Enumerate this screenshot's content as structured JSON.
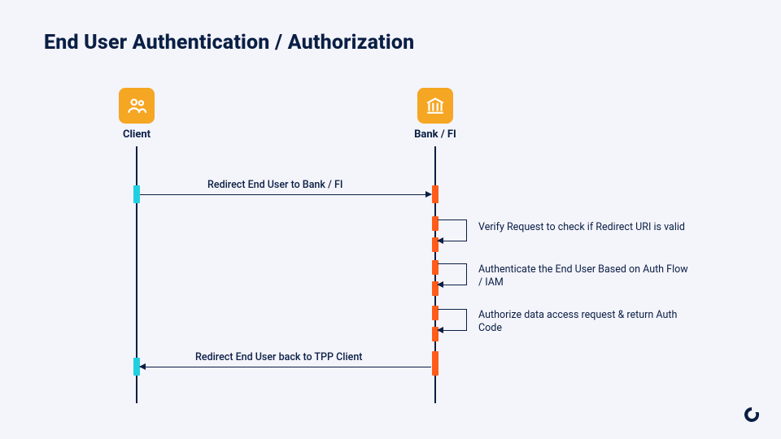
{
  "title": "End User Authentication /  Authorization",
  "actors": {
    "client": {
      "label": "Client",
      "icon": "people-icon"
    },
    "bank": {
      "label": "Bank / FI",
      "icon": "bank-icon"
    }
  },
  "messages": {
    "m1": "Redirect End User to Bank / FI",
    "s1": "Verify Request to check if Redirect URI is valid",
    "s2": "Authenticate the End User Based on Auth Flow / IAM",
    "s3": "Authorize data access request & return Auth Code",
    "m2": "Redirect End User back to TPP Client"
  },
  "colors": {
    "accent_orange": "#f5a623",
    "activation_orange": "#ff5c1a",
    "activation_teal": "#21d0e0",
    "line": "#0a1f44",
    "bg": "#f4f4fb"
  }
}
